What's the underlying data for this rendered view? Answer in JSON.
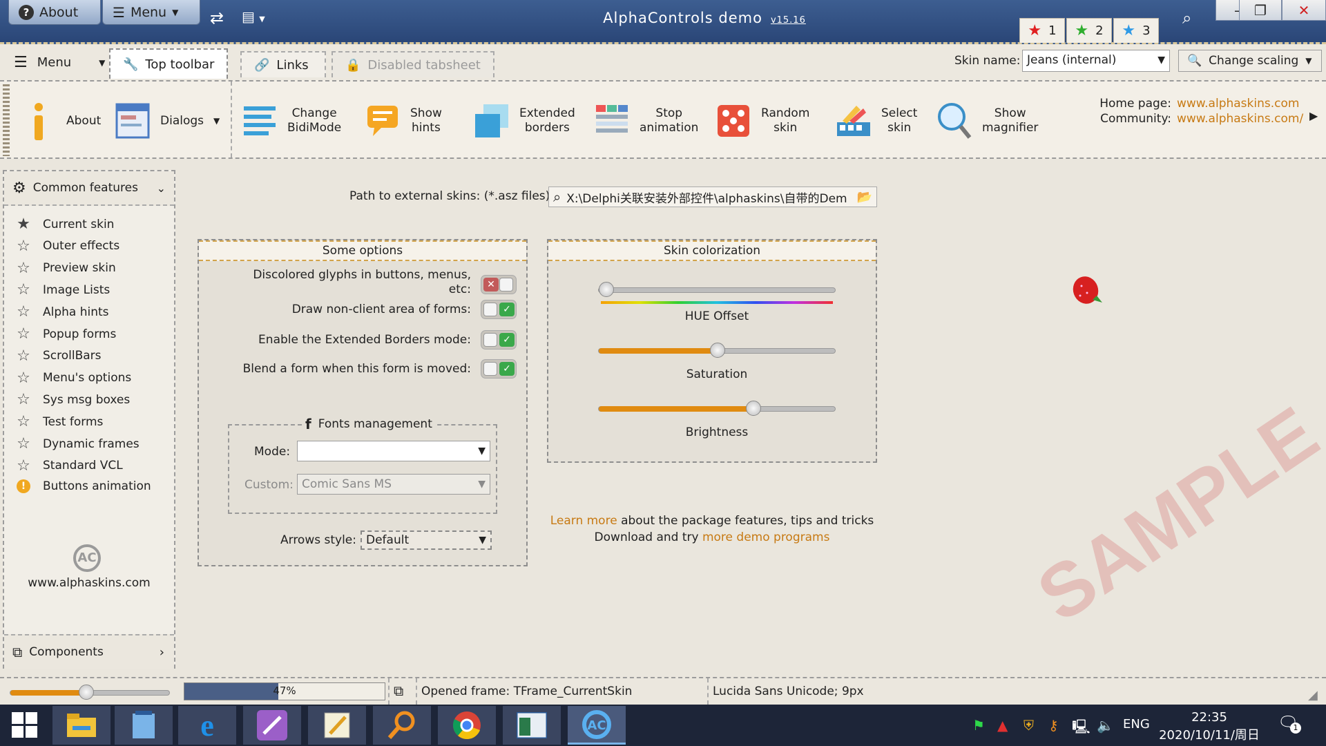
{
  "titlebar": {
    "about_label": "About",
    "menu_label": "Menu",
    "app_title": "AlphaControls demo",
    "version": "v15.16",
    "star_tabs": [
      {
        "num": "1",
        "color": "#e02020"
      },
      {
        "num": "2",
        "color": "#2fae2f"
      },
      {
        "num": "3",
        "color": "#2f9ae6"
      }
    ]
  },
  "tabrow": {
    "menu_label": "Menu",
    "tabs": [
      {
        "label": "Top toolbar",
        "icon": "wrench-icon",
        "state": "active"
      },
      {
        "label": "Links",
        "icon": "link-icon",
        "state": "normal"
      },
      {
        "label": "Disabled tabsheet",
        "icon": "lock-icon",
        "state": "disabled"
      }
    ],
    "skin_name_label": "Skin name:",
    "skin_name_value": "Jeans (internal)",
    "change_scaling_label": "Change scaling"
  },
  "toolbar": {
    "about": "About",
    "dialogs": "Dialogs",
    "change_bidimode": [
      "Change",
      "BidiMode"
    ],
    "show_hints": [
      "Show",
      "hints"
    ],
    "extended_borders": [
      "Extended",
      "borders"
    ],
    "stop_animation": [
      "Stop",
      "animation"
    ],
    "random_skin": [
      "Random",
      "skin"
    ],
    "select_skin": [
      "Select",
      "skin"
    ],
    "show_magnifier": [
      "Show",
      "magnifier"
    ],
    "home_page_label": "Home page:",
    "home_page_url": "www.alphaskins.com",
    "community_label": "Community:",
    "community_url": "www.alphaskins.com/"
  },
  "sidebar": {
    "header": "Common features",
    "items": [
      {
        "label": "Current skin",
        "icon": "filled-star-icon"
      },
      {
        "label": "Outer effects",
        "icon": "star-icon"
      },
      {
        "label": "Preview skin",
        "icon": "star-icon"
      },
      {
        "label": "Image Lists",
        "icon": "star-icon"
      },
      {
        "label": "Alpha hints",
        "icon": "star-icon"
      },
      {
        "label": "Popup forms",
        "icon": "star-icon"
      },
      {
        "label": "ScrollBars",
        "icon": "star-icon"
      },
      {
        "label": "Menu's options",
        "icon": "star-icon"
      },
      {
        "label": "Sys msg boxes",
        "icon": "star-icon"
      },
      {
        "label": "Test forms",
        "icon": "star-icon"
      },
      {
        "label": "Dynamic frames",
        "icon": "star-icon"
      },
      {
        "label": "Standard VCL",
        "icon": "star-icon"
      },
      {
        "label": "Buttons animation",
        "icon": "warning-icon"
      }
    ],
    "site": "www.alphaskins.com",
    "footer": "Components"
  },
  "main": {
    "path_label": "Path to external skins: (*.asz files)",
    "path_value": "X:\\Delphi关联安装外部控件\\alphaskins\\自带的Dem",
    "options": {
      "title": "Some options",
      "items": [
        {
          "label": "Discolored glyphs in buttons, menus, etc:",
          "on": false
        },
        {
          "label": "Draw non-client area of forms:",
          "on": true
        },
        {
          "label": "Enable the Extended Borders mode:",
          "on": true
        },
        {
          "label": "Blend a form when this form is moved:",
          "on": true
        }
      ],
      "fonts_title": "Fonts management",
      "mode_label": "Mode:",
      "mode_value": "",
      "custom_label": "Custom:",
      "custom_value": "Comic Sans MS",
      "arrows_label": "Arrows style:",
      "arrows_value": "Default"
    },
    "colorization": {
      "title": "Skin colorization",
      "hue_label": "HUE Offset",
      "hue_value": 0.0,
      "saturation_label": "Saturation",
      "saturation_value": 0.5,
      "brightness_label": "Brightness",
      "brightness_value": 0.66
    },
    "learn_more_link": "Learn more",
    "learn_more_rest": "about the package features, tips and tricks",
    "download_text": "Download and try",
    "demo_link": "more demo programs",
    "watermark": "SAMPLE"
  },
  "statusbar": {
    "slider_value": 0.47,
    "progress_value": 0.47,
    "progress_text": "47%",
    "frame_text": "Opened frame: TFrame_CurrentSkin",
    "font_text": "Lucida Sans Unicode; 9px"
  },
  "taskbar": {
    "lang": "ENG",
    "time": "22:35",
    "date": "2020/10/11/周日",
    "notif_count": "1"
  }
}
